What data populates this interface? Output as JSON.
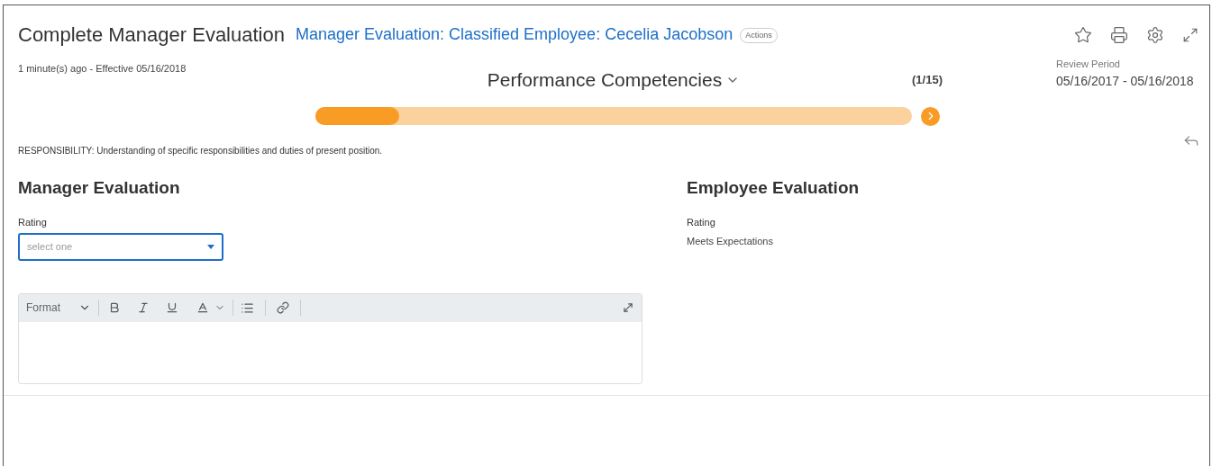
{
  "header": {
    "title": "Complete Manager Evaluation",
    "link": "Manager Evaluation: Classified Employee: Cecelia Jacobson",
    "actions_badge": "Actions",
    "subtitle": "1 minute(s) ago - Effective 05/16/2018"
  },
  "review_period": {
    "label": "Review Period",
    "value": "05/16/2017 - 05/16/2018"
  },
  "section": {
    "title": "Performance Competencies",
    "counter": "(1/15)",
    "level": 0.14
  },
  "responsibility": "RESPONSIBILITY: Understanding of specific responsibilities and duties of present position.",
  "manager": {
    "heading": "Manager Evaluation",
    "rating_label": "Rating",
    "placeholder": "select one",
    "editor": {
      "format_label": "Format"
    }
  },
  "employee": {
    "heading": "Employee Evaluation",
    "rating_label": "Rating",
    "rating_value": "Meets Expectations"
  }
}
